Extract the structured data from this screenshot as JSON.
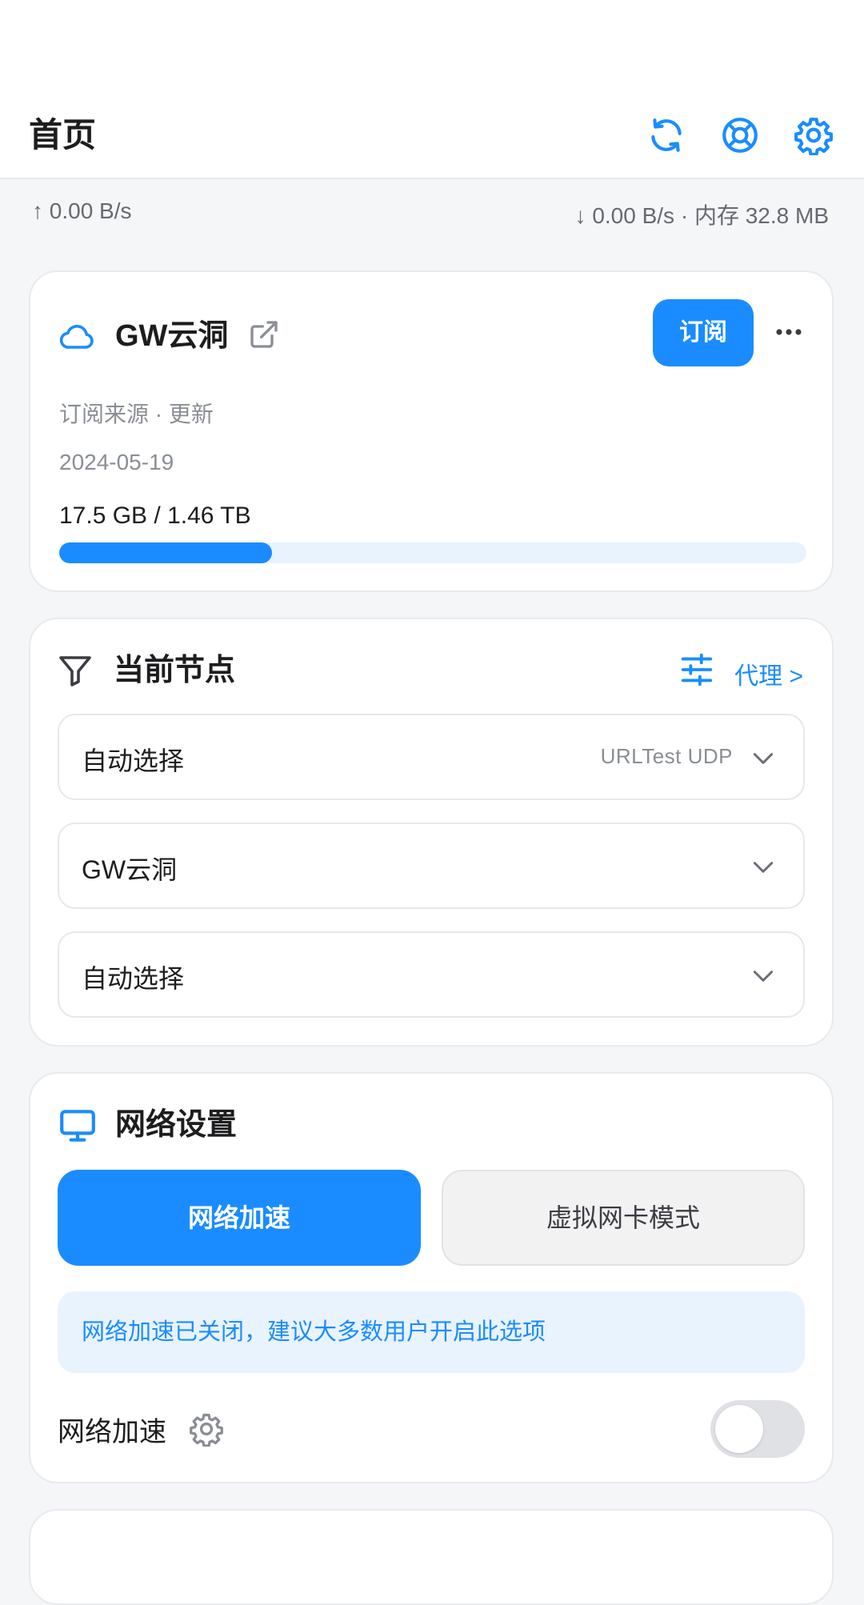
{
  "header": {
    "title": "首页",
    "icons": [
      "refresh-icon",
      "help-lifebuoy-icon",
      "gear-icon"
    ]
  },
  "stats": {
    "upload": "↑ 0.00 B/s",
    "download_memory": "↓ 0.00 B/s · 内存 32.8 MB"
  },
  "subscription": {
    "name": "GW云洞",
    "subscribe_label": "订阅",
    "source_text": "订阅来源 · 更新",
    "date": "2024-05-19",
    "usage_text": "17.5 GB / 1.46 TB",
    "usage_fraction": 0.285
  },
  "current_node": {
    "title": "当前节点",
    "proxy_link": "代理 >",
    "selects": [
      {
        "label": "自动选择",
        "tags": "URLTest  UDP"
      },
      {
        "label": "GW云洞",
        "tags": ""
      },
      {
        "label": "自动选择",
        "tags": ""
      }
    ]
  },
  "network": {
    "title": "网络设置",
    "mode_primary": "网络加速",
    "mode_secondary": "虚拟网卡模式",
    "notice": "网络加速已关闭，建议大多数用户开启此选项",
    "toggle_label": "网络加速",
    "toggle_on": false
  },
  "colors": {
    "accent": "#1a8cff",
    "accent_light": "#e9f3fe",
    "background": "#f5f6f8"
  }
}
